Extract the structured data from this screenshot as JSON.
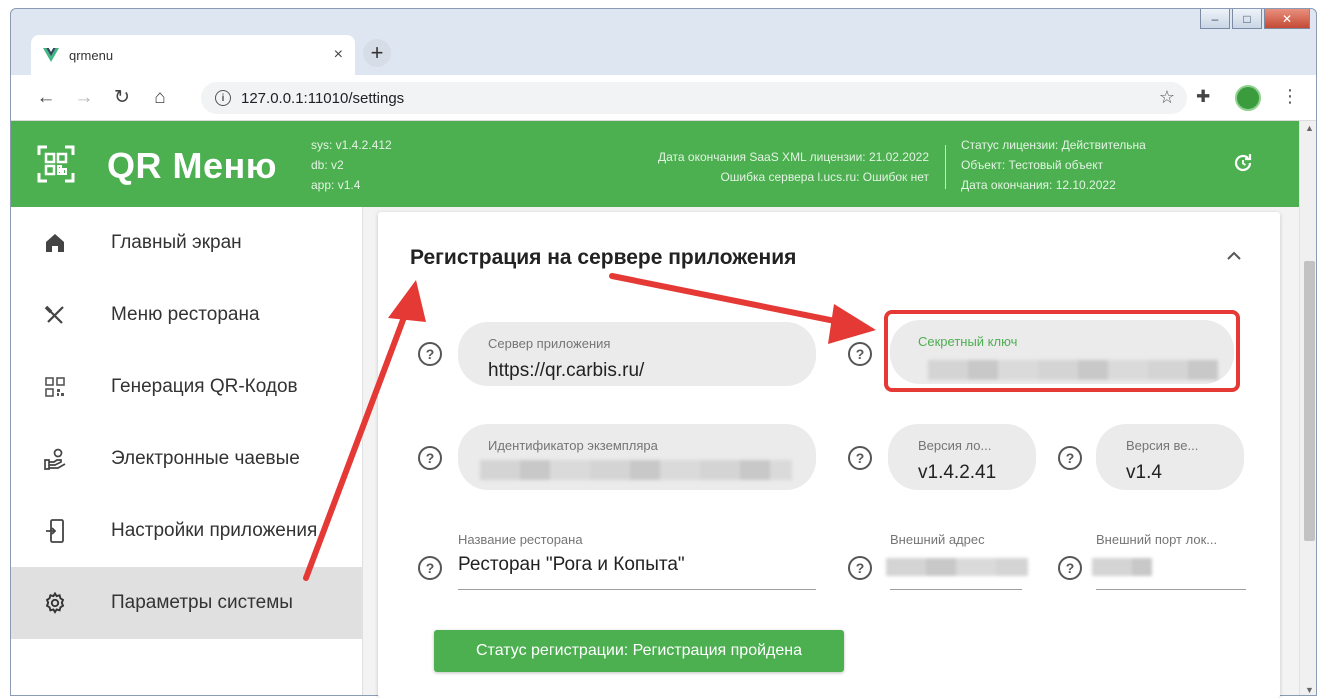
{
  "window": {
    "minimize_glyph": "‒",
    "maximize_glyph": "□",
    "close_glyph": "✕"
  },
  "browser": {
    "tab_title": "qrmenu",
    "tab_close": "×",
    "new_tab": "+",
    "url": "127.0.0.1:11010/settings",
    "back_glyph": "←",
    "forward_glyph": "→",
    "reload_glyph": "↻",
    "home_glyph": "⌂",
    "info_glyph": "i",
    "star_glyph": "☆",
    "extensions_glyph": "✚",
    "menu_glyph": "⋮"
  },
  "header": {
    "brand": "QR Меню",
    "sys_version": "sys: v1.4.2.412",
    "db_version": "db: v2",
    "app_version": "app: v1.4",
    "saas_license_end": "Дата окончания SaaS XML лицензии: 21.02.2022",
    "server_error": "Ошибка сервера l.ucs.ru: Ошибок нет",
    "license_status": "Статус лицензии: Действительна",
    "object": "Объект: Тестовый объект",
    "license_end": "Дата окончания: 12.10.2022"
  },
  "sidebar": {
    "items": [
      {
        "label": "Главный экран",
        "icon": "home-icon"
      },
      {
        "label": "Меню ресторана",
        "icon": "utensils-icon"
      },
      {
        "label": "Генерация QR-Кодов",
        "icon": "qr-code-icon"
      },
      {
        "label": "Электронные чаевые",
        "icon": "hand-tip-icon"
      },
      {
        "label": "Настройки приложения",
        "icon": "app-settings-icon"
      },
      {
        "label": "Параметры системы",
        "icon": "gear-icon",
        "active": true
      }
    ]
  },
  "main": {
    "section_title": "Регистрация на сервере приложения",
    "help_glyph": "?",
    "fields": {
      "app_server_label": "Сервер приложения",
      "app_server_value": "https://qr.carbis.ru/",
      "secret_key_label": "Секретный ключ",
      "instance_id_label": "Идентификатор экземпляра",
      "local_version_label": "Версия ло...",
      "local_version_value": "v1.4.2.41",
      "web_version_label": "Версия ве...",
      "web_version_value": "v1.4",
      "restaurant_name_label": "Название ресторана",
      "restaurant_name_value": "Ресторан \"Рога и Копыта\"",
      "external_address_label": "Внешний адрес",
      "external_port_label": "Внешний порт лок..."
    },
    "registration_status": "Статус регистрации: Регистрация пройдена"
  },
  "colors": {
    "brand_green": "#4caf50",
    "accent_green_label": "#4caf50",
    "annotation_red": "#e53935"
  }
}
